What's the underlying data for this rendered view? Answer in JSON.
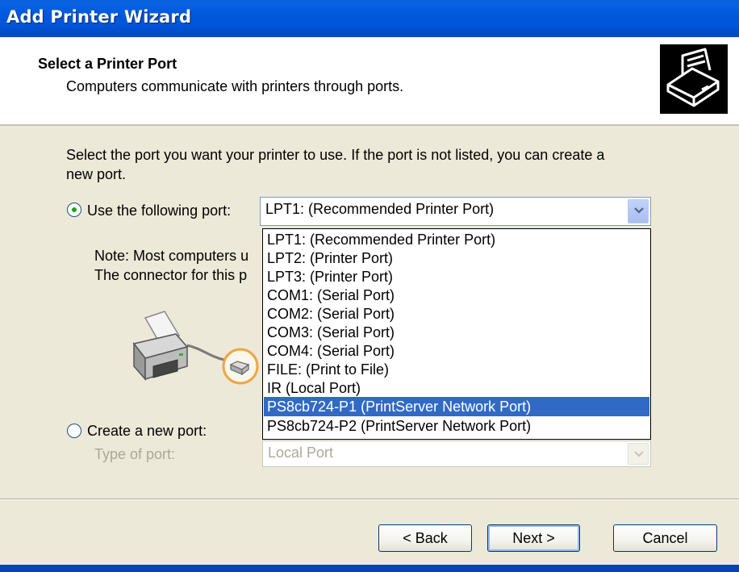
{
  "window": {
    "title": "Add Printer Wizard"
  },
  "header": {
    "title": "Select a Printer Port",
    "subtitle": "Computers communicate with printers through ports.",
    "icon": "printer-port-icon"
  },
  "content": {
    "instruction_line1": "Select the port you want your printer to use.  If the port is not listed, you can create a",
    "instruction_line2": "new port.",
    "use_port_label": "Use the following port:",
    "use_port_selected": true,
    "port_combo_value": "LPT1: (Recommended Printer Port)",
    "note_line1": "Note: Most computers u",
    "note_line2": "The connector for this p",
    "create_port_label": "Create a new port:",
    "create_port_selected": false,
    "type_of_port_label": "Type of port:",
    "type_of_port_value": "Local Port"
  },
  "dropdown": {
    "items": [
      "LPT1: (Recommended Printer Port)",
      "LPT2: (Printer Port)",
      "LPT3: (Printer Port)",
      "COM1: (Serial Port)",
      "COM2: (Serial Port)",
      "COM3: (Serial Port)",
      "COM4: (Serial Port)",
      "FILE: (Print to File)",
      "IR (Local Port)",
      "PS8cb724-P1 (PrintServer Network Port)",
      "PS8cb724-P2 (PrintServer Network Port)"
    ],
    "selected_index": 9
  },
  "buttons": {
    "back": "< Back",
    "next": "Next >",
    "cancel": "Cancel"
  },
  "colors": {
    "title_bar": "#0058de",
    "selection": "#316ac5",
    "dialog_bg": "#ece9d8",
    "port_highlight": "#f0a444"
  }
}
